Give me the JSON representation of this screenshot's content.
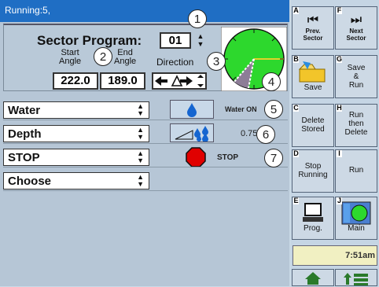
{
  "status": {
    "text": "Running:5,"
  },
  "sector": {
    "title": "Sector Program:",
    "program": "01",
    "start_label": "Start\nAngle",
    "end_label": "End\nAngle",
    "direction_label": "Direction",
    "start_angle": "222.0",
    "end_angle": "189.0"
  },
  "rows": [
    {
      "label": "Water",
      "value": "Water ON",
      "icon": "water-drop-icon"
    },
    {
      "label": "Depth",
      "value": "0.75",
      "icon": "depth-drops-icon"
    },
    {
      "label": "STOP",
      "value": "STOP",
      "icon": "stop-sign-icon"
    },
    {
      "label": "Choose",
      "value": "",
      "icon": ""
    }
  ],
  "callouts": [
    "1",
    "2",
    "3",
    "4",
    "5",
    "6",
    "7"
  ],
  "softkeys": [
    {
      "key": "A",
      "label": "Prev.\nSector"
    },
    {
      "key": "F",
      "label": "Next\nSector"
    },
    {
      "key": "B",
      "label": "Save"
    },
    {
      "key": "G",
      "label": "Save\n&\nRun"
    },
    {
      "key": "C",
      "label": "Delete\nStored"
    },
    {
      "key": "H",
      "label": "Run\nthen\nDelete"
    },
    {
      "key": "D",
      "label": "Stop\nRunning"
    },
    {
      "key": "I",
      "label": "Run"
    },
    {
      "key": "E",
      "label": "Prog."
    },
    {
      "key": "J",
      "label": "Main"
    }
  ],
  "clock": "7:51am",
  "colors": {
    "statusbar": "#1f6ec4",
    "panel": "#b6c6d6",
    "clock_bg": "#f1f0c2",
    "stop_red": "#e00000"
  }
}
